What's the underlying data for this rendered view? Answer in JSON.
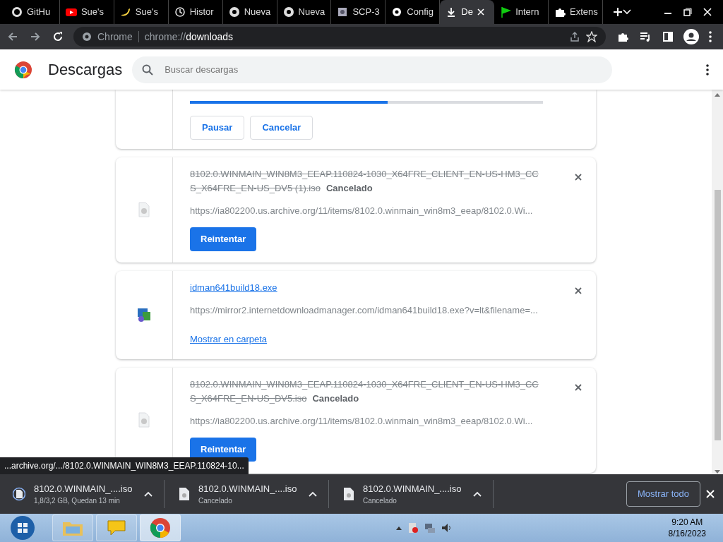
{
  "tabs": [
    {
      "label": "GitHu",
      "selected": false
    },
    {
      "label": "Sue's",
      "selected": false
    },
    {
      "label": "Sue's",
      "selected": false
    },
    {
      "label": "Histor",
      "selected": false
    },
    {
      "label": "Nueva",
      "selected": false
    },
    {
      "label": "Nueva",
      "selected": false
    },
    {
      "label": "SCP-3",
      "selected": false
    },
    {
      "label": "Config",
      "selected": false
    },
    {
      "label": "De",
      "selected": true
    },
    {
      "label": "Intern",
      "selected": false
    },
    {
      "label": "Extens",
      "selected": false
    }
  ],
  "address_bar": {
    "origin": "Chrome",
    "url_prefix": "chrome://",
    "url_host": "downloads"
  },
  "header": {
    "title": "Descargas",
    "search_placeholder": "Buscar descargas"
  },
  "downloads": [
    {
      "kind": "in_progress",
      "level": 0.56,
      "buttons": [
        "Pausar",
        "Cancelar"
      ]
    },
    {
      "kind": "cancelled",
      "filename": "8102.0.WINMAIN_WIN8M3_EEAP.110824-1030_X64FRE_CLIENT_EN-US-HM3_CCS_X64FRE_EN-US_DV5 (1).iso",
      "status": "Cancelado",
      "url": "https://ia802200.us.archive.org/11/items/8102.0.winmain_win8m3_eeap/8102.0.Wi...",
      "action": "Reintentar"
    },
    {
      "kind": "complete",
      "filename": "idman641build18.exe",
      "url": "https://mirror2.internetdownloadmanager.com/idman641build18.exe?v=lt&filename=...",
      "action": "Mostrar en carpeta"
    },
    {
      "kind": "cancelled",
      "filename": "8102.0.WINMAIN_WIN8M3_EEAP.110824-1030_X64FRE_CLIENT_EN-US-HM3_CCS_X64FRE_EN-US_DV5.iso",
      "status": "Cancelado",
      "url": "https://ia802200.us.archive.org/11/items/8102.0.winmain_win8m3_eeap/8102.0.Wi...",
      "action": "Reintentar"
    }
  ],
  "status_link": "...archive.org/.../8102.0.WINMAIN_WIN8M3_EEAP.110824-10...",
  "shelf": {
    "items": [
      {
        "name": "8102.0.WINMAIN_....iso",
        "status": "1,8/3,2 GB, Quedan 13 min",
        "kind": "in_progress"
      },
      {
        "name": "8102.0.WINMAIN_....iso",
        "status": "Cancelado",
        "kind": "cancelled"
      },
      {
        "name": "8102.0.WINMAIN_....iso",
        "status": "Cancelado",
        "kind": "cancelled"
      }
    ],
    "show_all": "Mostrar todo"
  },
  "taskbar": {
    "apps": [
      {
        "selected": false
      },
      {
        "selected": false
      },
      {
        "selected": true
      }
    ],
    "time": "9:20 AM",
    "date": "8/16/2023"
  }
}
